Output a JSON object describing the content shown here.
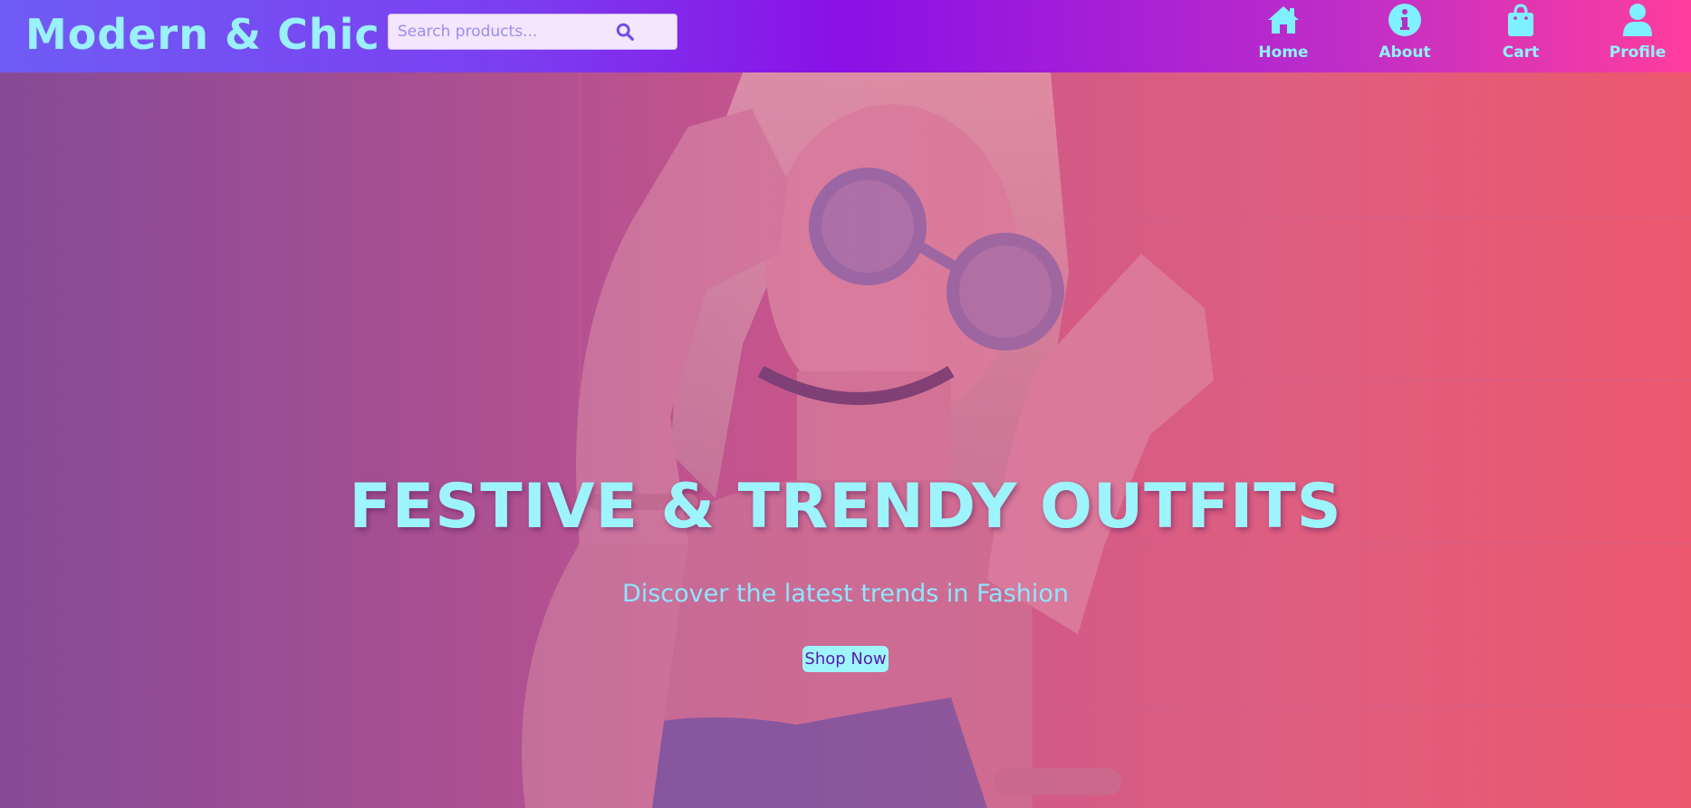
{
  "header": {
    "logo": "Modern & Chic",
    "search": {
      "placeholder": "Search products...",
      "value": ""
    },
    "nav": [
      {
        "label": "Home",
        "icon": "home-icon"
      },
      {
        "label": "About",
        "icon": "info-icon"
      },
      {
        "label": "Cart",
        "icon": "shopping-bag-icon"
      },
      {
        "label": "Profile",
        "icon": "user-icon"
      }
    ]
  },
  "hero": {
    "title": "FESTIVE & TRENDY OUTFITS",
    "subtitle": "Discover the latest trends in Fashion",
    "cta_label": "Shop Now"
  },
  "colors": {
    "accent_cyan": "#9ef4fb",
    "header_gradient_start": "#6f5cf5",
    "header_gradient_mid": "#8a10e6",
    "header_gradient_end": "#ff3d9d",
    "button_text": "#5a18b0"
  }
}
